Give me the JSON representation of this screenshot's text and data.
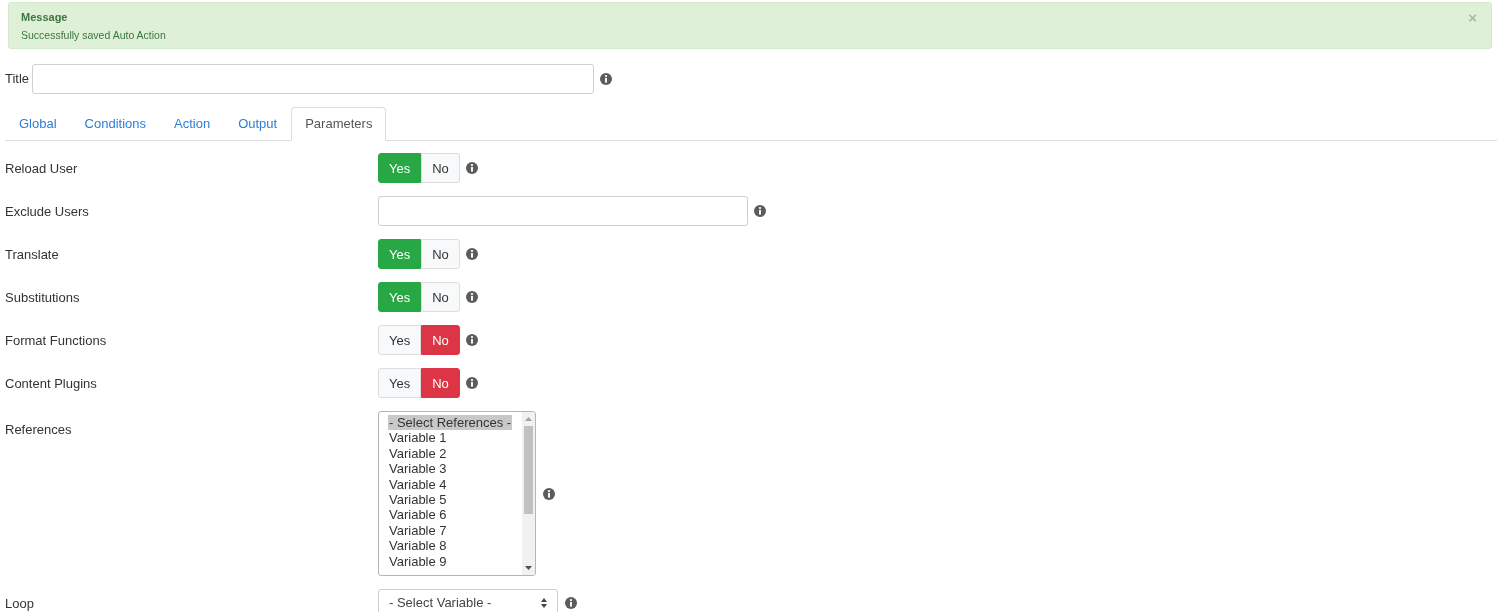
{
  "alert": {
    "title": "Message",
    "message": "Successfully saved Auto Action",
    "close": "×"
  },
  "title_field": {
    "label": "Title"
  },
  "tabs": [
    {
      "label": "Global",
      "selected": false
    },
    {
      "label": "Conditions",
      "selected": false
    },
    {
      "label": "Action",
      "selected": false
    },
    {
      "label": "Output",
      "selected": false
    },
    {
      "label": "Parameters",
      "selected": true
    }
  ],
  "rows": [
    {
      "kind": "toggle",
      "label": "Reload User",
      "options": [
        {
          "kind": "yes",
          "label": "Yes",
          "selected": true
        },
        {
          "kind": "no",
          "label": "No",
          "selected": false
        }
      ]
    },
    {
      "kind": "text",
      "label": "Exclude Users"
    },
    {
      "kind": "toggle",
      "label": "Translate",
      "options": [
        {
          "kind": "yes",
          "label": "Yes",
          "selected": true
        },
        {
          "kind": "no",
          "label": "No",
          "selected": false
        }
      ]
    },
    {
      "kind": "toggle",
      "label": "Substitutions",
      "options": [
        {
          "kind": "yes",
          "label": "Yes",
          "selected": true
        },
        {
          "kind": "no",
          "label": "No",
          "selected": false
        }
      ]
    },
    {
      "kind": "toggle",
      "label": "Format Functions",
      "options": [
        {
          "kind": "yes",
          "label": "Yes",
          "selected": false
        },
        {
          "kind": "no",
          "label": "No",
          "selected": true
        }
      ]
    },
    {
      "kind": "toggle",
      "label": "Content Plugins",
      "options": [
        {
          "kind": "yes",
          "label": "Yes",
          "selected": false
        },
        {
          "kind": "no",
          "label": "No",
          "selected": true
        }
      ]
    },
    {
      "kind": "listbox",
      "label": "References",
      "items": [
        {
          "label": "- Select References -",
          "selected": true
        },
        {
          "label": "Variable 1",
          "selected": false
        },
        {
          "label": "Variable 2",
          "selected": false
        },
        {
          "label": "Variable 3",
          "selected": false
        },
        {
          "label": "Variable 4",
          "selected": false
        },
        {
          "label": "Variable 5",
          "selected": false
        },
        {
          "label": "Variable 6",
          "selected": false
        },
        {
          "label": "Variable 7",
          "selected": false
        },
        {
          "label": "Variable 8",
          "selected": false
        },
        {
          "label": "Variable 9",
          "selected": false
        }
      ]
    },
    {
      "kind": "select",
      "label": "Loop",
      "value": "- Select Variable -"
    }
  ]
}
